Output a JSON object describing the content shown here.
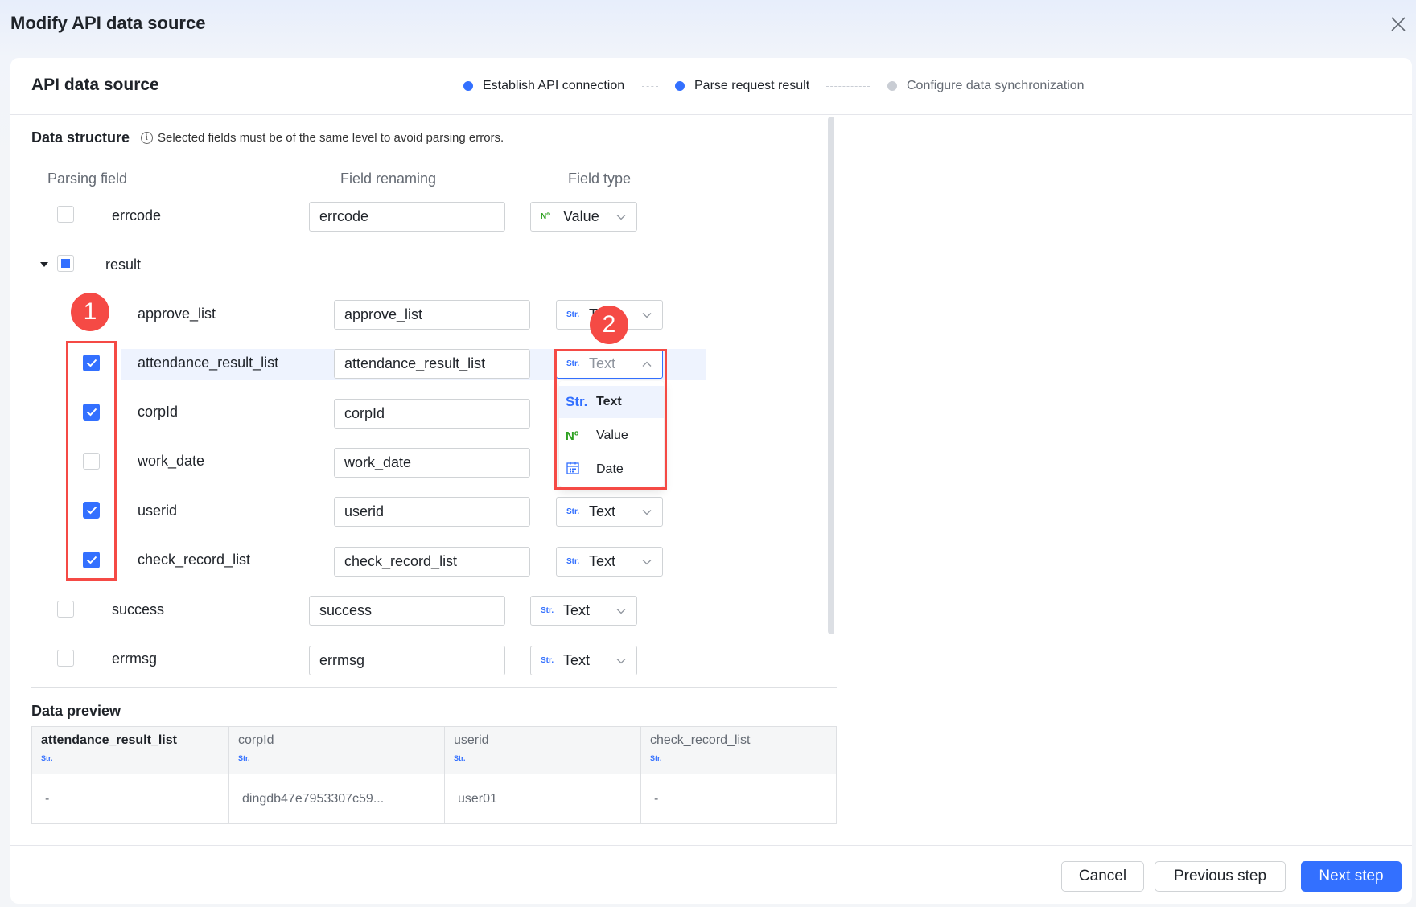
{
  "modal": {
    "title": "Modify API data source"
  },
  "panel": {
    "title": "API data source"
  },
  "steps": [
    {
      "label": "Establish API connection",
      "state": "done",
      "color": "#3370ff"
    },
    {
      "label": "Parse request result",
      "state": "active",
      "color": "#3370ff"
    },
    {
      "label": "Configure data synchronization",
      "state": "pending",
      "color": "#c9cdd4"
    }
  ],
  "structure": {
    "title": "Data structure",
    "hint": "Selected fields must be of the same level to avoid parsing errors.",
    "info_icon": "i",
    "col_parsing": "Parsing field",
    "col_renaming": "Field renaming",
    "col_type": "Field type",
    "top_fields": [
      {
        "name": "errcode",
        "rename": "errcode",
        "type": "Value",
        "tag": "Nº",
        "checked": false
      },
      {
        "name": "result",
        "checked": "partial",
        "expanded": true
      },
      {
        "name": "success",
        "rename": "success",
        "type": "Text",
        "tag": "Str.",
        "checked": false
      },
      {
        "name": "errmsg",
        "rename": "errmsg",
        "type": "Text",
        "tag": "Str.",
        "checked": false
      }
    ],
    "child_fields": [
      {
        "name": "approve_list",
        "rename": "approve_list",
        "type": "Text",
        "tag": "Str.",
        "checked": false
      },
      {
        "name": "attendance_result_list",
        "rename": "attendance_result_list",
        "type": "Text",
        "tag": "Str.",
        "checked": true
      },
      {
        "name": "corpId",
        "rename": "corpId",
        "checked": true
      },
      {
        "name": "work_date",
        "rename": "work_date",
        "checked": false
      },
      {
        "name": "userid",
        "rename": "userid",
        "type": "Text",
        "tag": "Str.",
        "checked": true
      },
      {
        "name": "check_record_list",
        "rename": "check_record_list",
        "type": "Text",
        "tag": "Str.",
        "checked": true
      }
    ]
  },
  "dropdown": {
    "options": [
      {
        "tag": "Str.",
        "label": "Text",
        "selected": true
      },
      {
        "tag": "Nº",
        "label": "Value"
      },
      {
        "tag": "calendar-icon",
        "label": "Date"
      }
    ]
  },
  "annotations": {
    "badge1": "1",
    "badge2": "2"
  },
  "preview": {
    "title": "Data preview",
    "columns": [
      {
        "name": "attendance_result_list",
        "tag": "Str.",
        "value": "-"
      },
      {
        "name": "corpId",
        "tag": "Str.",
        "value": "dingdb47e7953307c59..."
      },
      {
        "name": "userid",
        "tag": "Str.",
        "value": "user01"
      },
      {
        "name": "check_record_list",
        "tag": "Str.",
        "value": "-"
      }
    ]
  },
  "footer": {
    "cancel": "Cancel",
    "previous": "Previous step",
    "next": "Next step"
  },
  "colors": {
    "primary": "#3370ff",
    "value_green": "#2ea121",
    "annotation_red": "#f54a45"
  }
}
